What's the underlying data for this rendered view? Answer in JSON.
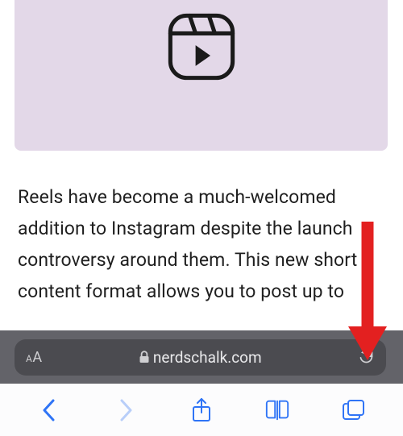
{
  "hero": {
    "icon_name": "reels-icon",
    "hero_bg": "#e3d8e8"
  },
  "article": {
    "paragraph": "Reels have become a much-welcomed addition to Instagram despite the launch controversy around them. This new short content format allows you to post up to"
  },
  "addressbar": {
    "text_size_label_small": "A",
    "text_size_label_large": "A",
    "domain": "nerdschalk.com",
    "lock_icon": "lock-icon",
    "reload_icon": "reload-icon"
  },
  "nav": {
    "back_icon": "chevron-left-icon",
    "forward_icon": "chevron-right-icon",
    "share_icon": "share-icon",
    "bookmarks_icon": "book-icon",
    "tabs_icon": "tabs-icon"
  },
  "colors": {
    "ios_blue": "#2f74f6",
    "ios_blue_disabled": "#b8cef9",
    "toolbar_bg": "#636369",
    "pill_bg": "#4b4b50",
    "arrow": "#e32020"
  },
  "annotation": {
    "arrow_points_to": "tabs-button"
  }
}
